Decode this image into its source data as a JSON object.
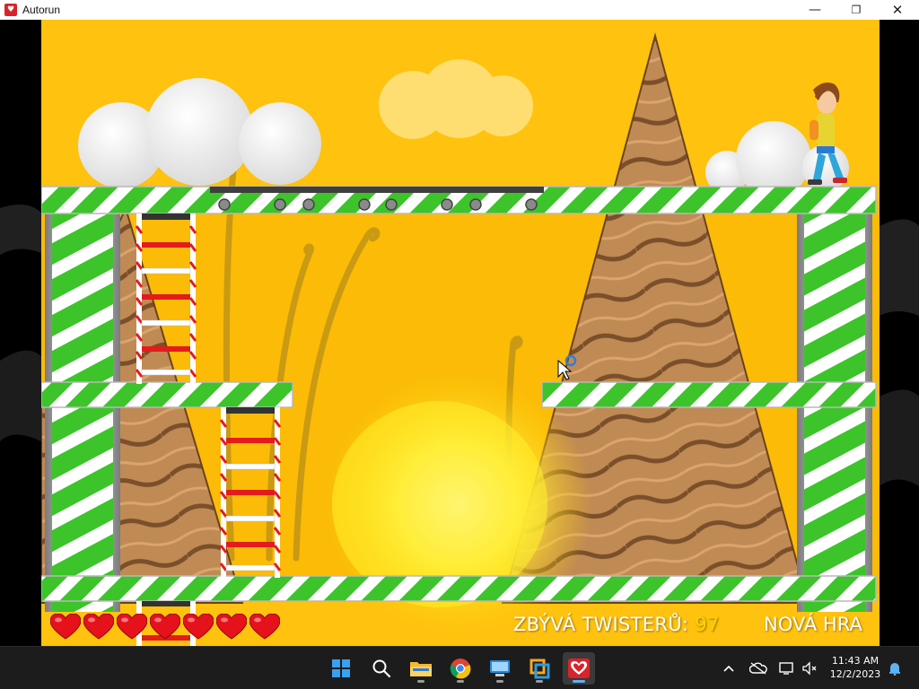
{
  "window": {
    "title": "Autorun",
    "controls": {
      "minimize": "—",
      "maximize": "❐",
      "close": "✕"
    }
  },
  "game": {
    "lives": 7,
    "twisters_label": "ZBÝVÁ TWISTERŮ:",
    "twisters_remaining": "97",
    "new_game_label": "NOVÁ HRA",
    "colors": {
      "sky": "#ffc20e",
      "stripe_green": "#3cc42a",
      "stripe_white": "#ffffff",
      "heart": "#e5121b",
      "counter_number": "#ffd400"
    }
  },
  "taskbar": {
    "apps": [
      "windows-start",
      "search",
      "file-explorer",
      "chrome",
      "remote-desktop",
      "virtual-machine",
      "autorun"
    ],
    "time": "11:43 AM",
    "date": "12/2/2023"
  }
}
